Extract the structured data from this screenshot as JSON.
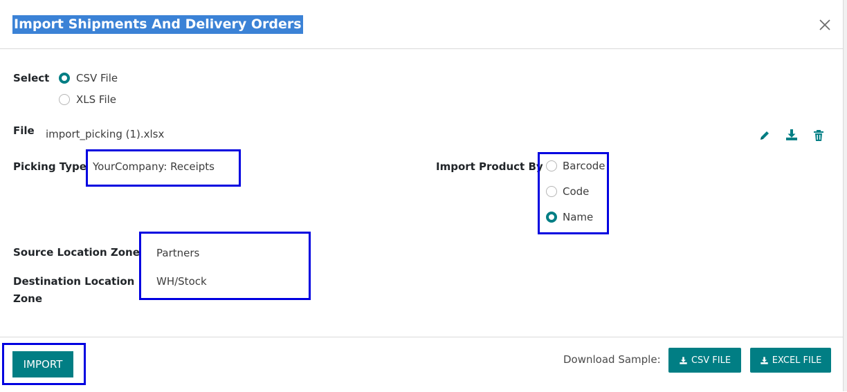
{
  "dialog": {
    "title": "Import Shipments And Delivery Orders"
  },
  "select": {
    "label": "Select",
    "options": [
      {
        "label": "CSV File",
        "checked": true
      },
      {
        "label": "XLS File",
        "checked": false
      }
    ]
  },
  "file": {
    "label": "File",
    "value": "import_picking (1).xlsx"
  },
  "picking_type": {
    "label": "Picking Type",
    "value": "YourCompany: Receipts"
  },
  "import_product_by": {
    "label": "Import Product By",
    "options": [
      {
        "label": "Barcode",
        "checked": false
      },
      {
        "label": "Code",
        "checked": false
      },
      {
        "label": "Name",
        "checked": true
      }
    ]
  },
  "source_location": {
    "label": "Source Location Zone",
    "value": "Partners"
  },
  "destination_location": {
    "label_line1": "Destination Location",
    "label_line2": "Zone",
    "value": "WH/Stock"
  },
  "footer": {
    "import_label": "IMPORT",
    "download_sample_label": "Download Sample:",
    "csv_button_label": "CSV FILE",
    "excel_button_label": "EXCEL FILE"
  },
  "colors": {
    "accent": "#017e84",
    "highlight_border": "#0000e0",
    "title_selection": "#3b82d6"
  },
  "icons": [
    "close-icon",
    "pencil-icon",
    "download-icon",
    "trash-icon"
  ]
}
